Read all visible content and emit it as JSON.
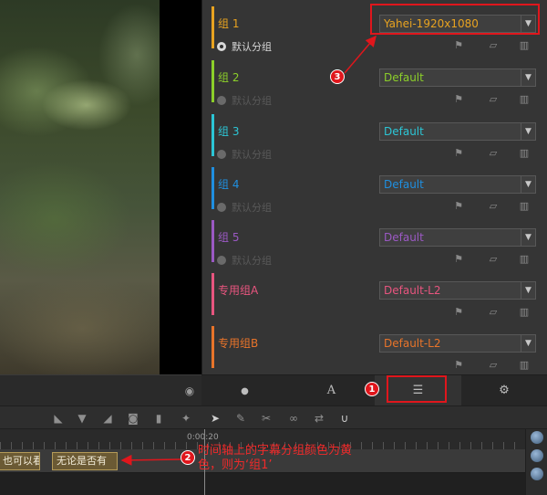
{
  "panel": {
    "groups": [
      {
        "label": "组 1",
        "color": "#e8a320",
        "label_color": "#e8a320",
        "preset": "Yahei-1920x1080",
        "preset_color": "#e8a320",
        "default_label": "默认分组",
        "default_active": true
      },
      {
        "label": "组 2",
        "color": "#8ccf2a",
        "label_color": "#8ccf2a",
        "preset": "Default",
        "preset_color": "#8ccf2a",
        "default_label": "默认分组",
        "default_active": false
      },
      {
        "label": "组 3",
        "color": "#2cc6d6",
        "label_color": "#2cc6d6",
        "preset": "Default",
        "preset_color": "#2cc6d6",
        "default_label": "默认分组",
        "default_active": false
      },
      {
        "label": "组 4",
        "color": "#1f8fe0",
        "label_color": "#1f8fe0",
        "preset": "Default",
        "preset_color": "#1f8fe0",
        "default_label": "默认分组",
        "default_active": false
      },
      {
        "label": "组 5",
        "color": "#9b59c4",
        "label_color": "#9b59c4",
        "preset": "Default",
        "preset_color": "#9b59c4",
        "default_label": "默认分组",
        "default_active": false
      },
      {
        "label": "专用组A",
        "color": "#e8557f",
        "label_color": "#e8557f",
        "preset": "Default-L2",
        "preset_color": "#e8557f",
        "default_label": "",
        "default_active": false
      },
      {
        "label": "专用组B",
        "color": "#e8742a",
        "label_color": "#e8742a",
        "preset": "Default-L2",
        "preset_color": "#e8742a",
        "default_label": "",
        "default_active": false
      }
    ],
    "row_icons": [
      "flag-icon",
      "eraser-icon",
      "trash-icon"
    ]
  },
  "tabs": [
    {
      "name": "comment-tab",
      "icon": "chat-bubble-icon",
      "glyph": "●"
    },
    {
      "name": "text-style-tab",
      "icon": "font-icon",
      "glyph": "A"
    },
    {
      "name": "list-tab",
      "icon": "list-icon",
      "glyph": "☰",
      "active": true
    },
    {
      "name": "settings-tab",
      "icon": "gear-icon",
      "glyph": "⚙"
    }
  ],
  "toolbar_icons": [
    "mark-in-icon",
    "marker-down-icon",
    "mark-out-icon",
    "camera-icon",
    "bookmark-icon",
    "wand-icon",
    "cursor-icon",
    "edit-icon",
    "scissors-icon",
    "link-icon",
    "swap-icon",
    "magnet-icon"
  ],
  "timeline": {
    "time_label": "0:00:20",
    "clips": [
      {
        "text": "也可以看,"
      },
      {
        "text": "无论是否有"
      }
    ]
  },
  "annotations": {
    "badge_1": "1",
    "badge_2": "2",
    "badge_3": "3",
    "note": "时间轴上的字幕分组颜色为黄色，则为‘组1’",
    "accent": "#e0161c"
  }
}
